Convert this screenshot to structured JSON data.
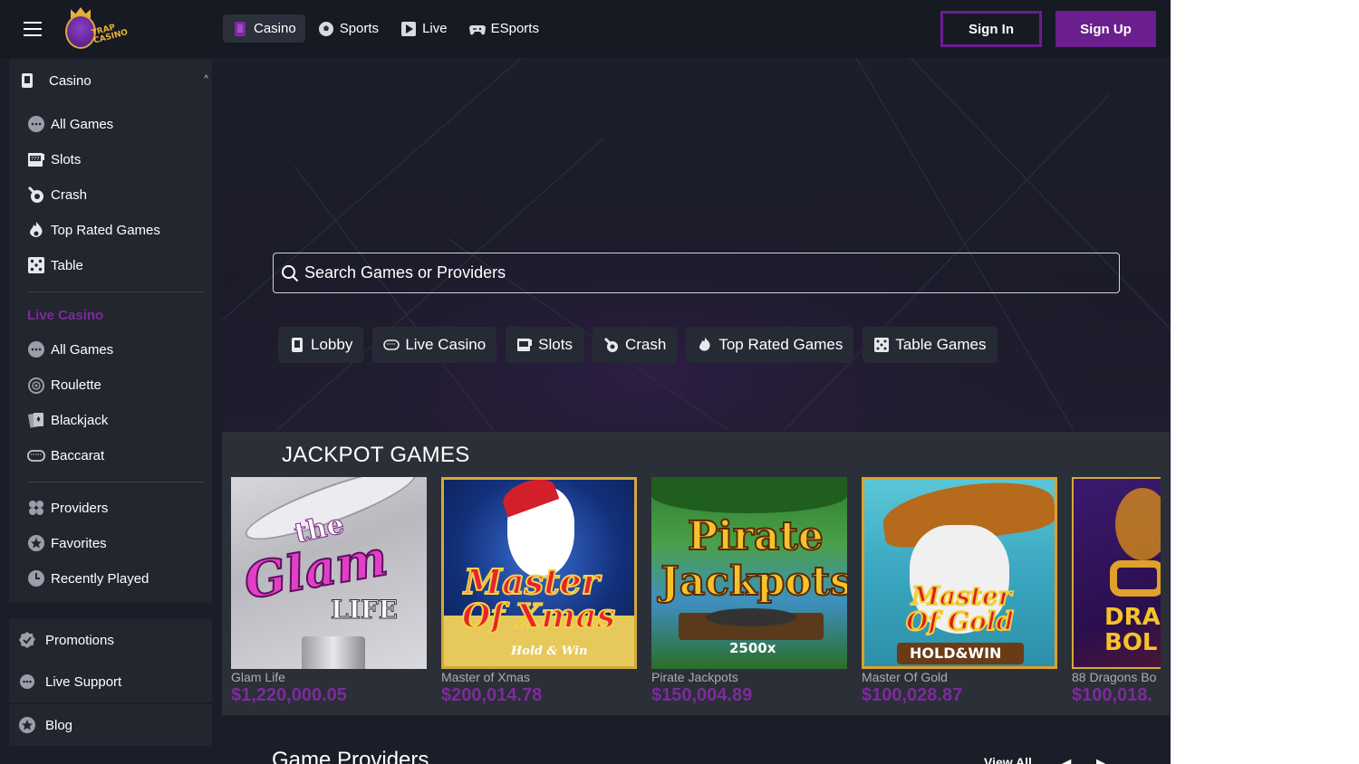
{
  "header": {
    "logo_text": "TRAP CASINO",
    "nav": [
      {
        "label": "Casino",
        "icon": "casino-card-icon",
        "active": true
      },
      {
        "label": "Sports",
        "icon": "soccer-ball-icon",
        "active": false
      },
      {
        "label": "Live",
        "icon": "play-icon",
        "active": false
      },
      {
        "label": "ESports",
        "icon": "gamepad-icon",
        "active": false
      }
    ],
    "sign_in": "Sign In",
    "sign_up": "Sign Up"
  },
  "sidebar": {
    "casino_header": "Casino",
    "casino_items": [
      {
        "label": "All Games",
        "icon": "chips-icon"
      },
      {
        "label": "Slots",
        "icon": "slot-machine-icon"
      },
      {
        "label": "Crash",
        "icon": "crash-icon"
      },
      {
        "label": "Top Rated Games",
        "icon": "flame-icon"
      },
      {
        "label": "Table",
        "icon": "dice-icon"
      }
    ],
    "live_section": "Live Casino",
    "live_items": [
      {
        "label": "All Games",
        "icon": "chips-icon"
      },
      {
        "label": "Roulette",
        "icon": "roulette-icon"
      },
      {
        "label": "Blackjack",
        "icon": "cards-icon"
      },
      {
        "label": "Baccarat",
        "icon": "baccarat-icon"
      }
    ],
    "extra_items": [
      {
        "label": "Providers",
        "icon": "clover-icon"
      },
      {
        "label": "Favorites",
        "icon": "star-icon"
      },
      {
        "label": "Recently Played",
        "icon": "clock-icon"
      }
    ],
    "promotions": "Promotions",
    "live_support": "Live Support",
    "blog": "Blog"
  },
  "search": {
    "placeholder": "Search Games or Providers"
  },
  "chips": [
    {
      "label": "Lobby",
      "icon": "casino-card-icon"
    },
    {
      "label": "Live Casino",
      "icon": "baccarat-icon"
    },
    {
      "label": "Slots",
      "icon": "slot-machine-icon"
    },
    {
      "label": "Crash",
      "icon": "crash-icon"
    },
    {
      "label": "Top Rated Games",
      "icon": "flame-icon"
    },
    {
      "label": "Table Games",
      "icon": "dice-icon"
    }
  ],
  "jackpot": {
    "title": "JACKPOT GAMES",
    "games": [
      {
        "name": "Glam Life",
        "amount": "$1,220,000.05",
        "art": [
          "the",
          "Glam",
          "LIFE"
        ]
      },
      {
        "name": "Master of Xmas",
        "amount": "$200,014.78",
        "art": [
          "Master",
          "Of Xmas",
          "Hold & Win"
        ]
      },
      {
        "name": "Pirate Jackpots",
        "amount": "$150,004.89",
        "art": [
          "Pirate",
          "Jackpots",
          "2500x"
        ]
      },
      {
        "name": "Master Of Gold",
        "amount": "$100,028.87",
        "art": [
          "Master",
          "Of Gold",
          "HOLD&WIN"
        ]
      },
      {
        "name": "88 Dragons Bo",
        "amount": "$100,018.",
        "art": [
          "DRA",
          "BOL"
        ]
      }
    ]
  },
  "providers": {
    "title": "Game Providers",
    "view_all": "View All",
    "prev": "◀",
    "next": "▶"
  },
  "colors": {
    "accent": "#6b1e8e",
    "amount": "#7e2a9e",
    "bg": "#1a1e29",
    "panel": "#22262f"
  }
}
